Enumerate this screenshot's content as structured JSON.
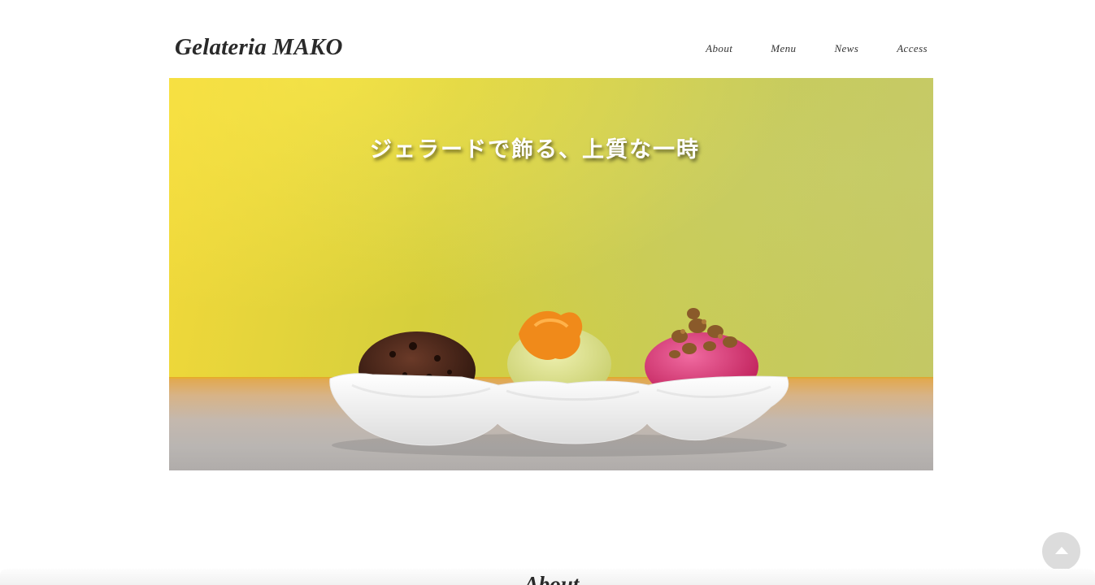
{
  "header": {
    "logo": "Gelateria MAKO",
    "nav": [
      {
        "label": "About"
      },
      {
        "label": "Menu"
      },
      {
        "label": "News"
      },
      {
        "label": "Access"
      }
    ]
  },
  "hero": {
    "headline": "ジェラードで飾る、上質な一時",
    "image_description_icon": "gelato-three-scoops-photo"
  },
  "about": {
    "heading": "About"
  },
  "scroll_top": {
    "icon": "triangle-up-icon"
  },
  "colors": {
    "wall_yellow": "#e3d43c",
    "scroll_button": "#dcdcdc",
    "text": "#2a2a2a"
  }
}
